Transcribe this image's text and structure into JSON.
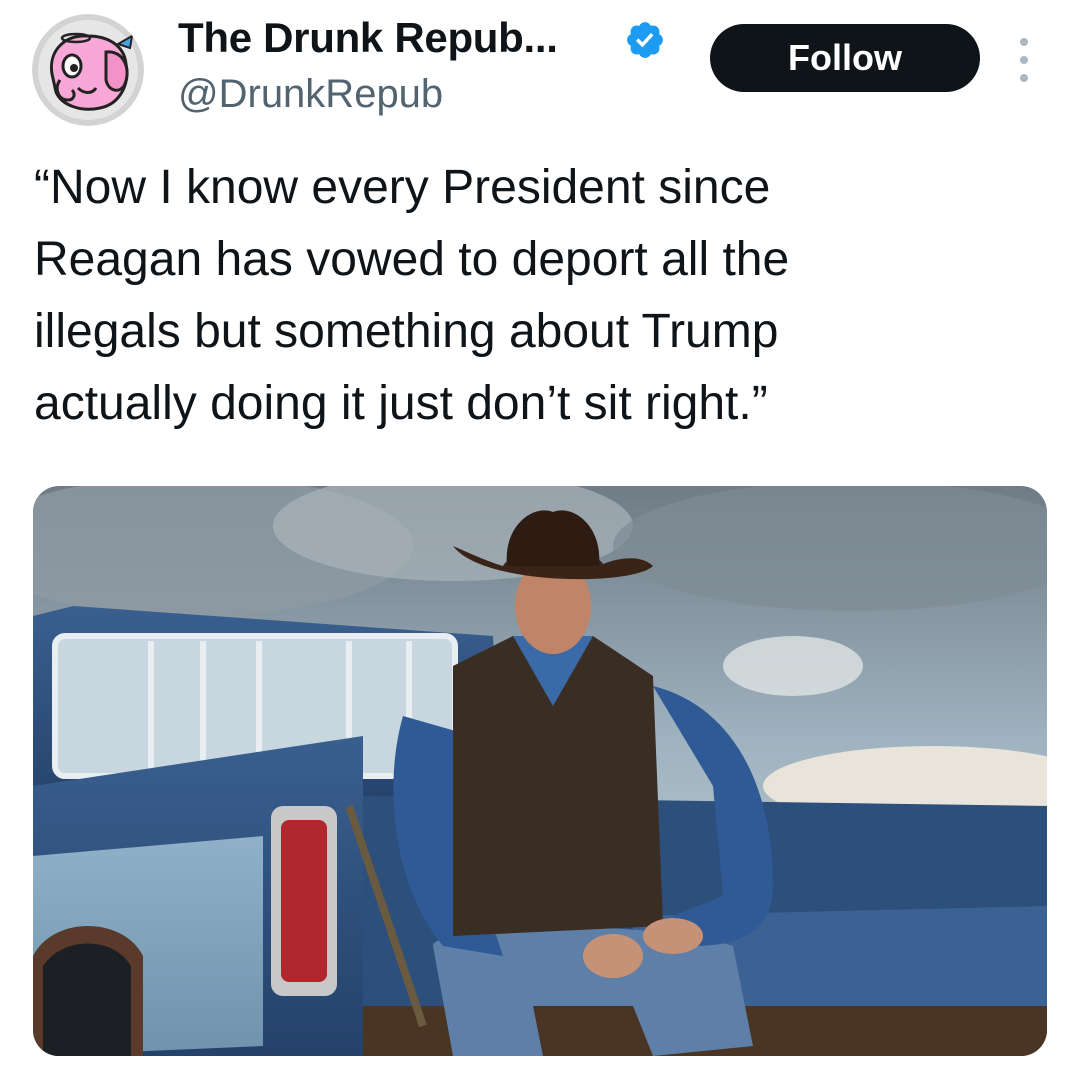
{
  "author": {
    "display_name": "The Drunk Repub...",
    "handle": "@DrunkRepub",
    "verified": true,
    "avatar_icon": "drunk-elephant-avatar-icon",
    "verified_icon": "verified-badge-icon"
  },
  "actions": {
    "follow_label": "Follow",
    "more_icon": "more-options-icon"
  },
  "tweet": {
    "lines": [
      "“Now I know every President since",
      "Reagan has vowed to deport all the",
      "illegals but something about Trump",
      "actually doing it just don’t sit right.”"
    ]
  },
  "media": {
    "type": "photo",
    "icon": "photo-cowboy-pickup-truck"
  },
  "colors": {
    "text": "#0f1419",
    "secondary_text": "#536471",
    "verified_blue": "#1d9bf0",
    "follow_button_bg": "#0f1419",
    "follow_button_text": "#ffffff",
    "avatar_pink": "#f7a8d6"
  }
}
